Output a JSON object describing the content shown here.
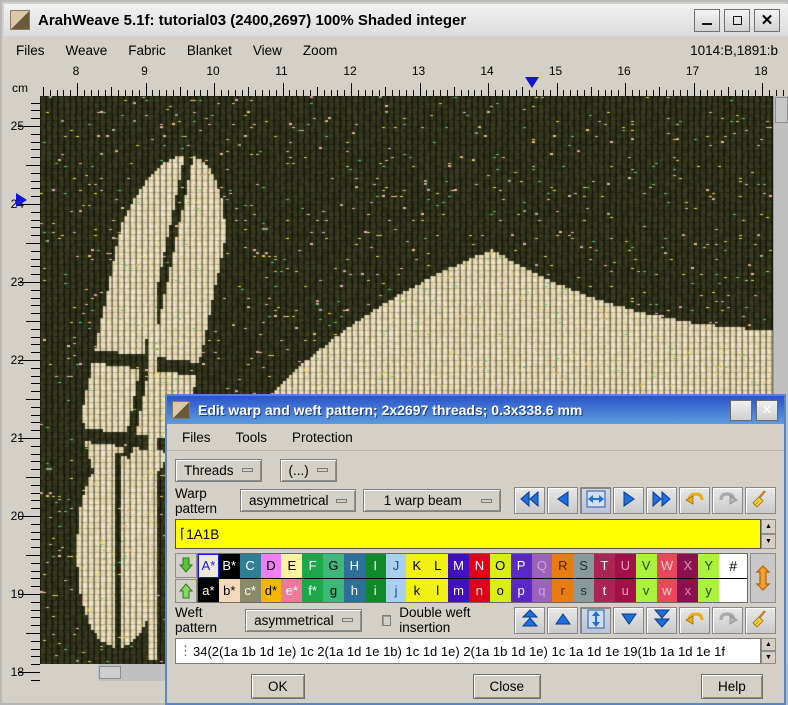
{
  "window": {
    "title": "ArahWeave 5.1f: tutorial03 (2400,2697) 100% Shaded integer",
    "minimize_label": "_",
    "maximize_label": "□",
    "close_label": "✕",
    "menu": [
      "Files",
      "Weave",
      "Fabric",
      "Blanket",
      "View",
      "Zoom"
    ],
    "coordinates": "1014:B,1891:b"
  },
  "rulers": {
    "unit_label": "cm",
    "horizontal_ticks": [
      "8",
      "9",
      "10",
      "11",
      "12",
      "13",
      "14",
      "15",
      "16",
      "17",
      "18"
    ],
    "vertical_ticks": [
      "25",
      "24",
      "23",
      "22",
      "21",
      "20",
      "19",
      "18"
    ],
    "h_marker_value": "14.65",
    "v_marker_value": "23.8"
  },
  "dialog": {
    "title": "Edit warp and weft pattern; 2x2697 threads; 0.3x338.6 mm",
    "maximize_label": "□",
    "close_label": "✕",
    "menu": [
      "Files",
      "Tools",
      "Protection"
    ],
    "toolbar": {
      "threads_label": "Threads",
      "ellipsis_label": "(...)"
    },
    "warp": {
      "label": "Warp pattern",
      "symmetry": "asymmetrical",
      "beam": "1 warp beam",
      "pattern_value": "1A1B",
      "buttons": [
        {
          "name": "first",
          "glyph": "«"
        },
        {
          "name": "previous",
          "glyph": "◀"
        },
        {
          "name": "fit-width",
          "glyph": "↔"
        },
        {
          "name": "next",
          "glyph": "▶"
        },
        {
          "name": "last",
          "glyph": "»"
        },
        {
          "name": "undo",
          "glyph": "↶"
        },
        {
          "name": "redo",
          "glyph": "↷"
        },
        {
          "name": "clear",
          "glyph": "✐"
        }
      ]
    },
    "weft": {
      "label": "Weft pattern",
      "symmetry": "asymmetrical",
      "double_insertion_label": "Double weft insertion",
      "double_insertion_checked": false,
      "pattern_value": "34(2(1a 1b 1d 1e) 1c 2(1a 1d 1e 1b) 1c 1d 1e) 2(1a 1b 1d 1e) 1c 1a 1d 1e 19(1b 1a 1d 1e 1f",
      "buttons": [
        {
          "name": "top",
          "glyph": "▲"
        },
        {
          "name": "up",
          "glyph": "△"
        },
        {
          "name": "fit-height",
          "glyph": "↕"
        },
        {
          "name": "down",
          "glyph": "▽"
        },
        {
          "name": "bottom",
          "glyph": "▼"
        },
        {
          "name": "undo",
          "glyph": "↶"
        },
        {
          "name": "redo",
          "glyph": "↷"
        },
        {
          "name": "clear",
          "glyph": "✐"
        }
      ]
    },
    "palette": {
      "hash_label": "#",
      "upper": [
        {
          "label": "A*",
          "bg": "#eeead8",
          "fg": "#1414ff"
        },
        {
          "label": "B*",
          "bg": "#000000",
          "fg": "#ffffff"
        },
        {
          "label": "C",
          "bg": "#2f7e96",
          "fg": "#ffffff"
        },
        {
          "label": "D",
          "bg": "#f07ef0",
          "fg": "#000000"
        },
        {
          "label": "E",
          "bg": "#fcf2a0",
          "fg": "#000000"
        },
        {
          "label": "F",
          "bg": "#1aa84a",
          "fg": "#ffffff"
        },
        {
          "label": "G",
          "bg": "#3cb878",
          "fg": "#000000"
        },
        {
          "label": "H",
          "bg": "#2d6f96",
          "fg": "#ffffff"
        },
        {
          "label": "I",
          "bg": "#0f8a2a",
          "fg": "#ffffff"
        },
        {
          "label": "J",
          "bg": "#a8d0f0",
          "fg": "#2a4a7a"
        },
        {
          "label": "K",
          "bg": "#f2f212",
          "fg": "#000000"
        },
        {
          "label": "L",
          "bg": "#f2f212",
          "fg": "#000000"
        },
        {
          "label": "M",
          "bg": "#4010c0",
          "fg": "#ffffff"
        },
        {
          "label": "N",
          "bg": "#e00018",
          "fg": "#ffffff"
        },
        {
          "label": "O",
          "bg": "#d8ee14",
          "fg": "#000000"
        },
        {
          "label": "P",
          "bg": "#5a28c8",
          "fg": "#ffffff"
        },
        {
          "label": "Q",
          "bg": "#9a62b8",
          "fg": "#c8a8d8"
        },
        {
          "label": "R",
          "bg": "#e87c10",
          "fg": "#4a2a00"
        },
        {
          "label": "S",
          "bg": "#8a9a9a",
          "fg": "#203030"
        },
        {
          "label": "T",
          "bg": "#ab2454",
          "fg": "#ffffff"
        },
        {
          "label": "U",
          "bg": "#a31048",
          "fg": "#e8a0c0"
        },
        {
          "label": "V",
          "bg": "#aaf23c",
          "fg": "#2a4a00"
        },
        {
          "label": "W",
          "bg": "#e8485a",
          "fg": "#ffd0d0"
        },
        {
          "label": "X",
          "bg": "#8a1050",
          "fg": "#e090b0"
        },
        {
          "label": "Y",
          "bg": "#aaf23c",
          "fg": "#2a4a00"
        }
      ],
      "lower": [
        {
          "label": "a*",
          "bg": "#000000",
          "fg": "#ffffff"
        },
        {
          "label": "b*",
          "bg": "#f8d8bc",
          "fg": "#000000"
        },
        {
          "label": "c*",
          "bg": "#8a8a6a",
          "fg": "#ffffff"
        },
        {
          "label": "d*",
          "bg": "#f2b800",
          "fg": "#000000"
        },
        {
          "label": "e*",
          "bg": "#f07898",
          "fg": "#ffffff"
        },
        {
          "label": "f*",
          "bg": "#1aa84a",
          "fg": "#ffffff"
        },
        {
          "label": "g",
          "bg": "#3cb878",
          "fg": "#000000"
        },
        {
          "label": "h",
          "bg": "#2d6f96",
          "fg": "#ffffff"
        },
        {
          "label": "i",
          "bg": "#0f8a2a",
          "fg": "#ffffff"
        },
        {
          "label": "j",
          "bg": "#a8d0f0",
          "fg": "#2a4a7a"
        },
        {
          "label": "k",
          "bg": "#f2f212",
          "fg": "#000000"
        },
        {
          "label": "l",
          "bg": "#f2f212",
          "fg": "#000000"
        },
        {
          "label": "m",
          "bg": "#4010c0",
          "fg": "#ffffff"
        },
        {
          "label": "n",
          "bg": "#e00018",
          "fg": "#ffffff"
        },
        {
          "label": "o",
          "bg": "#d8ee14",
          "fg": "#000000"
        },
        {
          "label": "p",
          "bg": "#5a28c8",
          "fg": "#ffffff"
        },
        {
          "label": "q",
          "bg": "#9a62b8",
          "fg": "#c8a8d8"
        },
        {
          "label": "r",
          "bg": "#e87c10",
          "fg": "#4a2a00"
        },
        {
          "label": "s",
          "bg": "#8a9a9a",
          "fg": "#203030"
        },
        {
          "label": "t",
          "bg": "#ab2454",
          "fg": "#ffffff"
        },
        {
          "label": "u",
          "bg": "#a31048",
          "fg": "#e8a0c0"
        },
        {
          "label": "v",
          "bg": "#aaf23c",
          "fg": "#2a4a00"
        },
        {
          "label": "w",
          "bg": "#e8485a",
          "fg": "#ffd0d0"
        },
        {
          "label": "x",
          "bg": "#8a1050",
          "fg": "#e090b0"
        },
        {
          "label": "y",
          "bg": "#aaf23c",
          "fg": "#2a4a00"
        }
      ]
    },
    "actions": {
      "ok": "OK",
      "close": "Close",
      "help": "Help"
    }
  },
  "colors": {
    "accent_blue": "#2a55c8",
    "pattern_field_yellow": "#ffff00",
    "marker_blue": "#1414d2",
    "face_gray": "#d4d0c8"
  }
}
